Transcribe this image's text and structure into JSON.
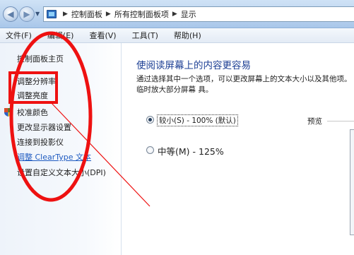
{
  "address_bar": {
    "breadcrumbs": [
      "控制面板",
      "所有控制面板项",
      "显示"
    ]
  },
  "menu": {
    "items": [
      "文件(F)",
      "编辑(E)",
      "查看(V)",
      "工具(T)",
      "帮助(H)"
    ]
  },
  "sidebar": {
    "items": [
      {
        "label": "控制面板主页"
      },
      {
        "label": "调整分辨率"
      },
      {
        "label": "调整亮度"
      },
      {
        "label": "校准颜色"
      },
      {
        "label": "更改显示器设置"
      },
      {
        "label": "连接到投影仪"
      },
      {
        "label": "调整 ClearType 文本"
      },
      {
        "label": "设置自定义文本大小(DPI)"
      }
    ]
  },
  "main": {
    "title": "使阅读屏幕上的内容更容易",
    "description": "通过选择其中一个选项，可以更改屏幕上的文本大小以及其他项。 临时放大部分屏幕 具。",
    "options": [
      {
        "label": "较小(S) - 100% (默认)",
        "selected": true
      },
      {
        "label": "中等(M) - 125%",
        "selected": false
      }
    ],
    "preview_label": "预览"
  },
  "colors": {
    "annotation": "#ee1111",
    "title_blue": "#1c3f94",
    "link_blue": "#1f5bc1"
  }
}
